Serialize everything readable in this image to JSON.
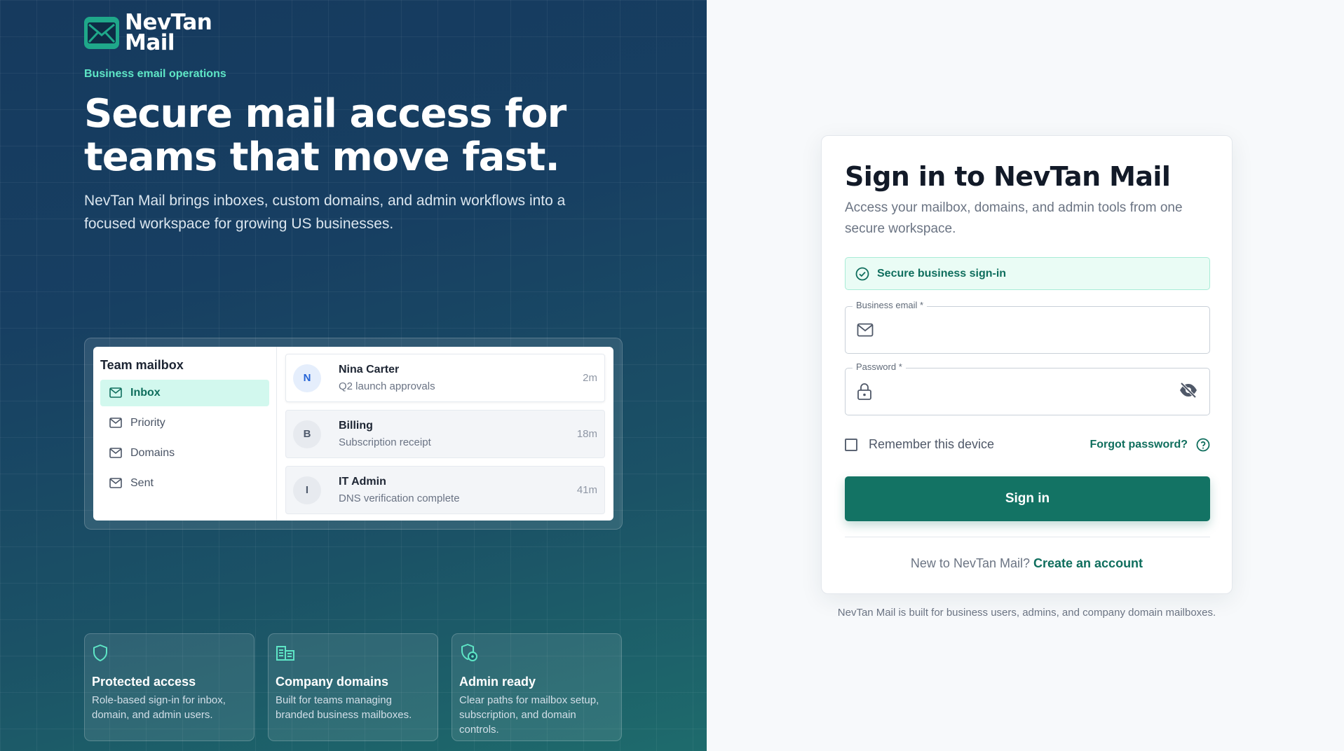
{
  "brand": {
    "name_line1": "NevTan",
    "name_line2": "Mail",
    "logo_icon": "envelope-icon",
    "color": "#1fa88a"
  },
  "hero": {
    "eyebrow": "Business email operations",
    "title": "Secure mail access for teams that move fast.",
    "subtitle": "NevTan Mail brings inboxes, custom domains, and admin workflows into a focused workspace for growing US businesses."
  },
  "preview": {
    "title": "Team mailbox",
    "folders": [
      {
        "label": "Inbox",
        "active": true
      },
      {
        "label": "Priority",
        "active": false
      },
      {
        "label": "Domains",
        "active": false
      },
      {
        "label": "Sent",
        "active": false
      }
    ],
    "messages": [
      {
        "initial": "N",
        "from": "Nina Carter",
        "subject": "Q2 launch approvals",
        "time": "2m"
      },
      {
        "initial": "B",
        "from": "Billing",
        "subject": "Subscription receipt",
        "time": "18m"
      },
      {
        "initial": "I",
        "from": "IT Admin",
        "subject": "DNS verification complete",
        "time": "41m"
      }
    ]
  },
  "features": [
    {
      "icon": "shield-icon",
      "title": "Protected access",
      "desc": "Role-based sign-in for inbox, domain, and admin users."
    },
    {
      "icon": "building-icon",
      "title": "Company domains",
      "desc": "Built for teams managing branded business mailboxes."
    },
    {
      "icon": "admin-shield-icon",
      "title": "Admin ready",
      "desc": "Clear paths for mailbox setup, subscription, and domain controls."
    }
  ],
  "signin": {
    "title": "Sign in to NevTan Mail",
    "subtitle": "Access your mailbox, domains, and admin tools from one secure workspace.",
    "secure_badge": "Secure business sign-in",
    "email_label": "Business email *",
    "email_value": "",
    "password_label": "Password *",
    "password_value": "",
    "remember_label": "Remember this device",
    "remember_checked": false,
    "forgot_label": "Forgot password?",
    "submit_label": "Sign in",
    "signup_prompt": "New to NevTan Mail?",
    "signup_link": "Create an account",
    "accent": "#137364"
  },
  "footnote": "NevTan Mail is built for business users, admins, and company domain mailboxes."
}
